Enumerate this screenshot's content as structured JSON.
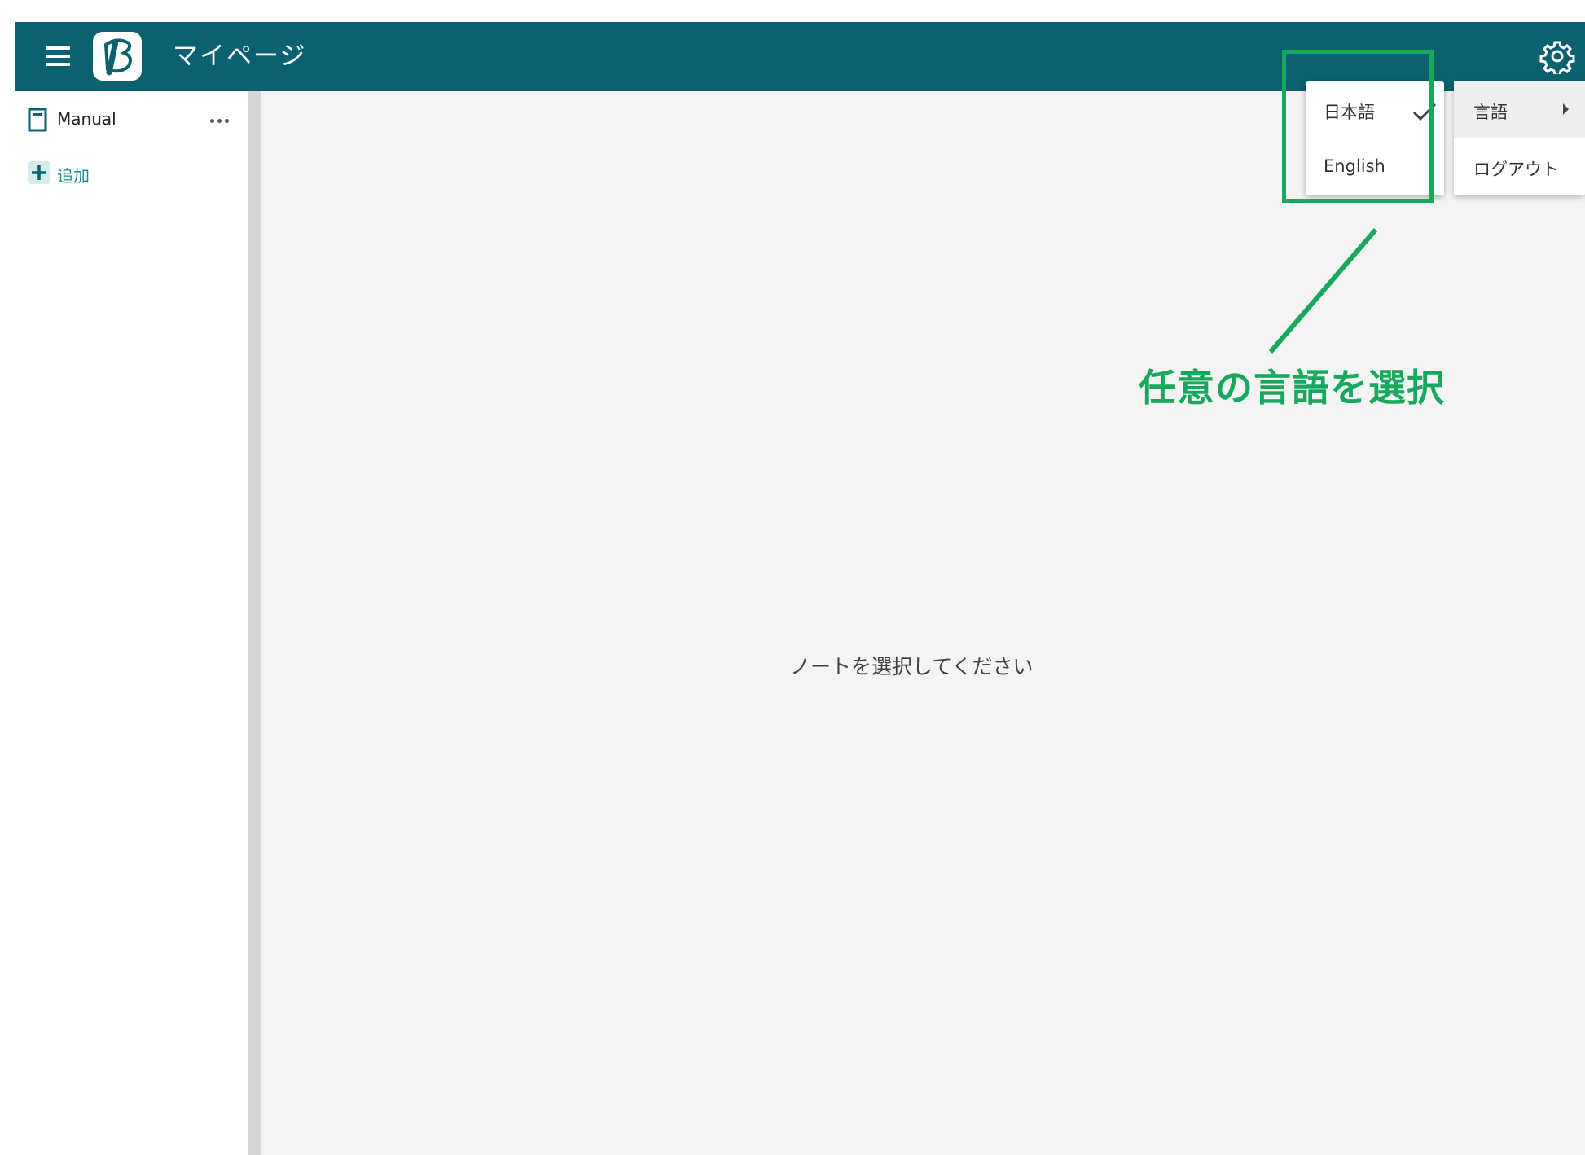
{
  "header": {
    "page_title": "マイページ",
    "menu_icon": "hamburger-menu-icon",
    "logo_icon": "b-logo-icon",
    "settings_icon": "gear-icon",
    "bar_color": "#0c6170"
  },
  "sidebar": {
    "notebook_label": "Manual",
    "add_label": "追加"
  },
  "main": {
    "empty_message": "ノートを選択してください"
  },
  "settings_menu": {
    "items": [
      {
        "label": "言語",
        "has_submenu": true
      },
      {
        "label": "ログアウト"
      }
    ]
  },
  "language_menu": {
    "items": [
      {
        "label": "日本語",
        "selected": true
      },
      {
        "label": "English",
        "selected": false
      }
    ]
  },
  "annotation": {
    "text": "任意の言語を選択",
    "color": "#16a85c"
  }
}
